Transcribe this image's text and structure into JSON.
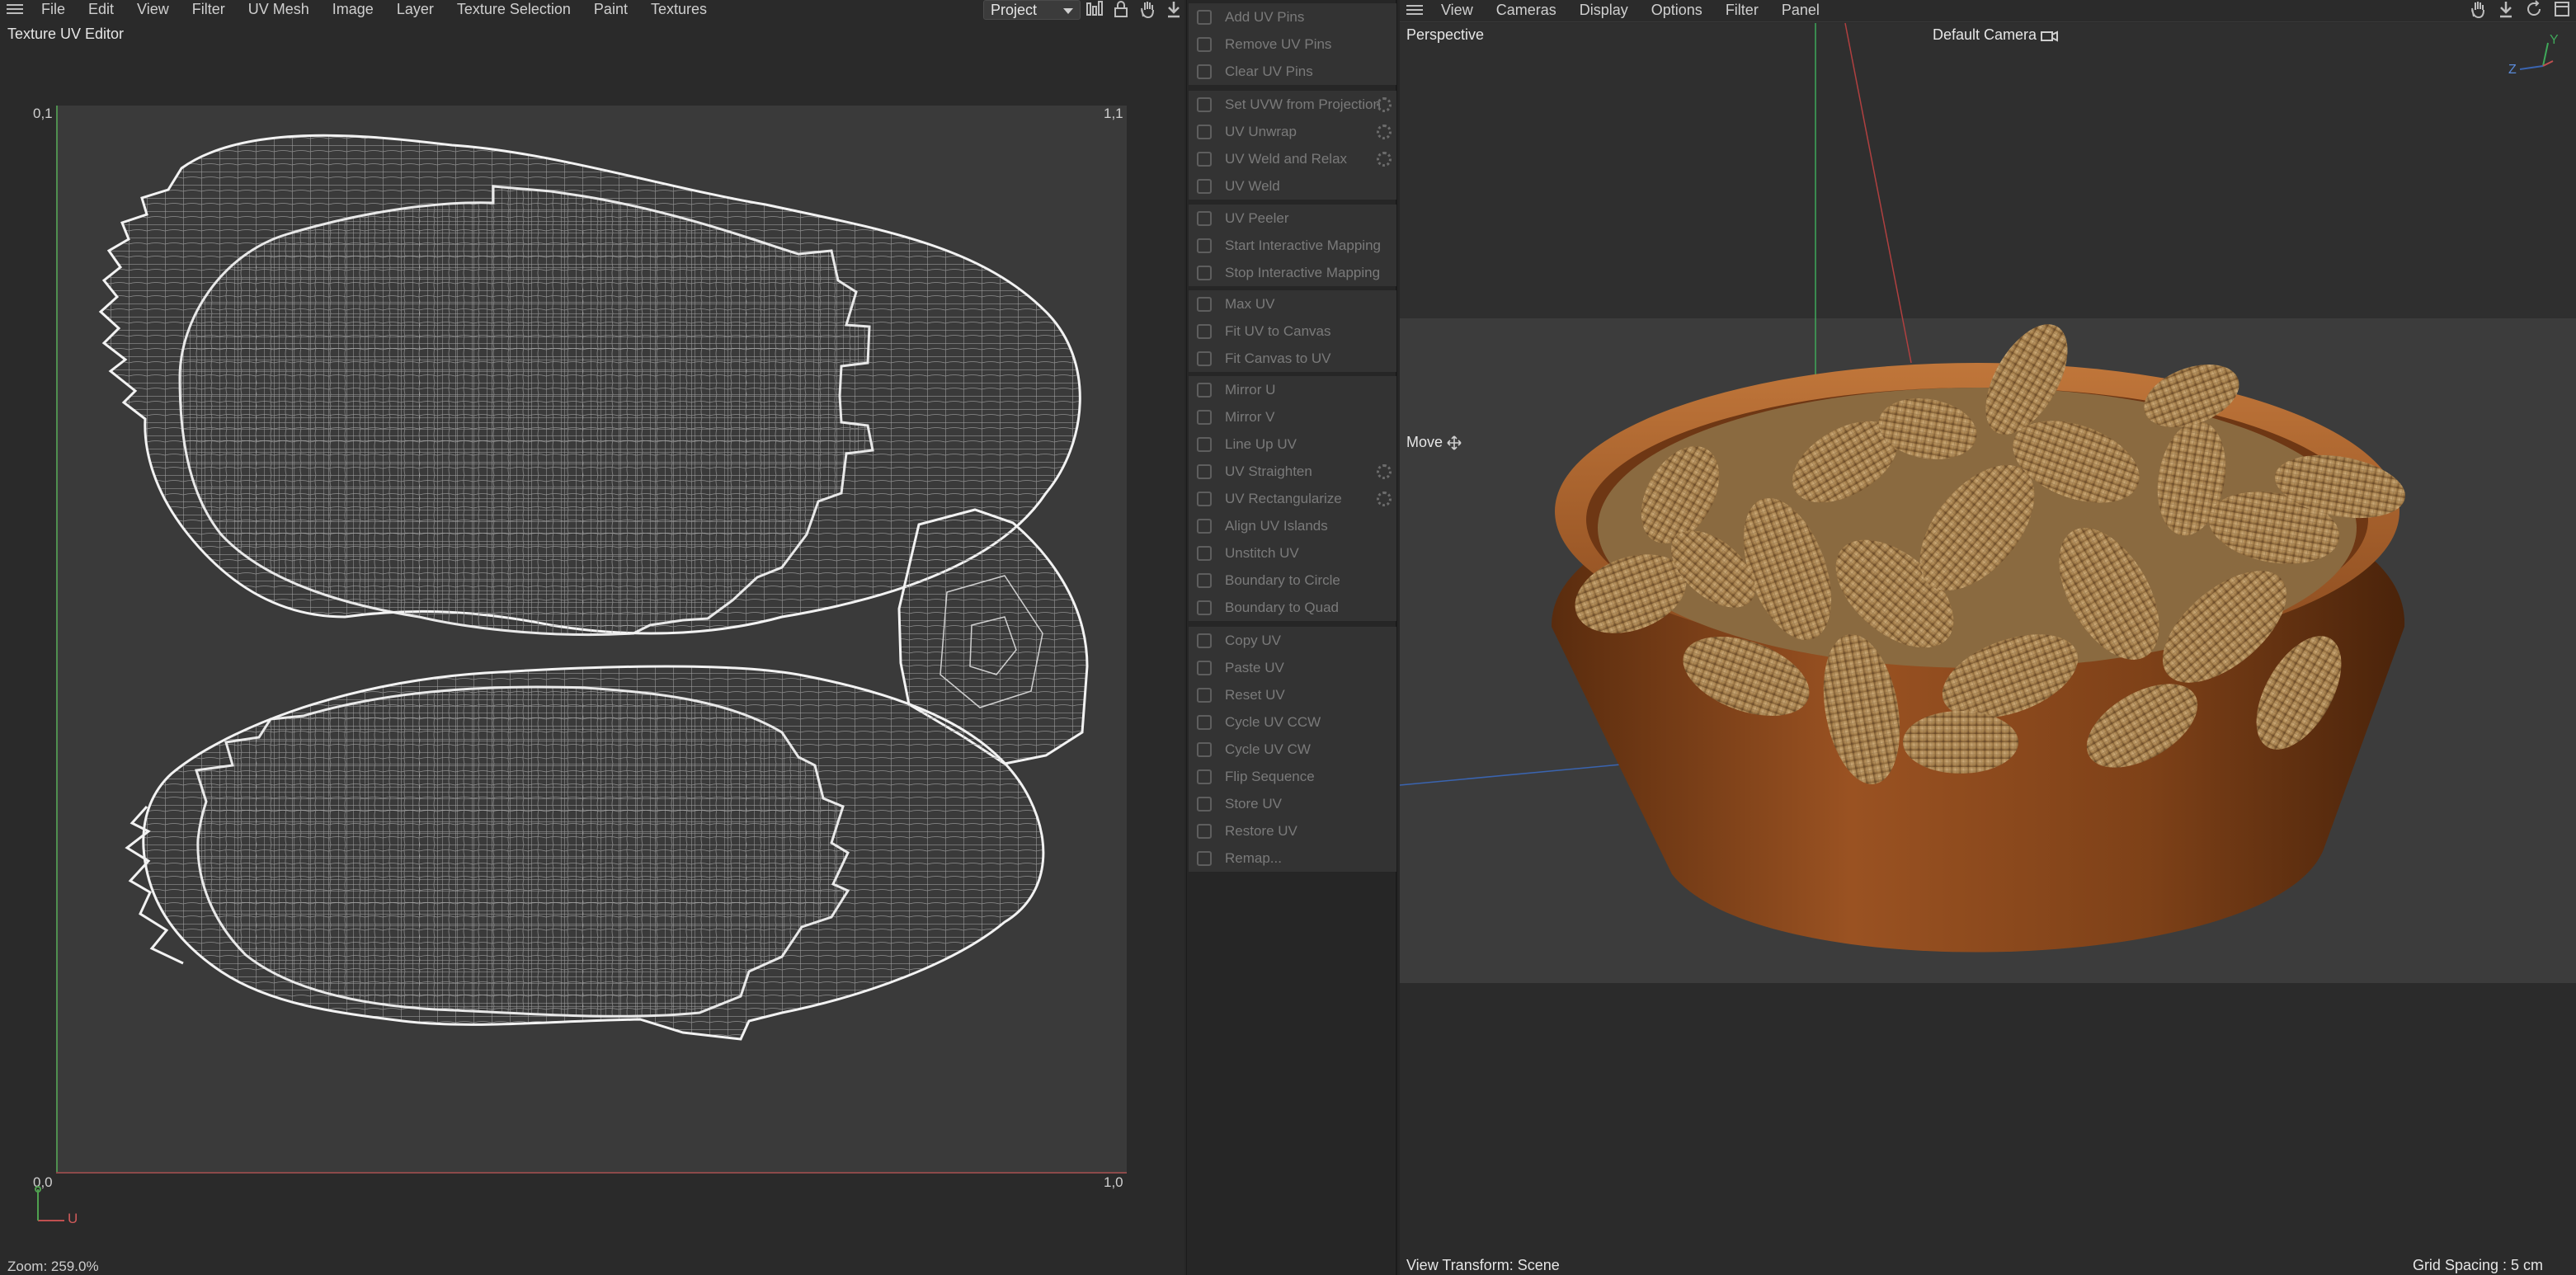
{
  "uv_editor": {
    "menu": [
      "File",
      "Edit",
      "View",
      "Filter",
      "UV Mesh",
      "Image",
      "Layer",
      "Texture Selection",
      "Paint",
      "Textures"
    ],
    "title": "Texture UV Editor",
    "project_select": "Project",
    "toolbar_icons": [
      "layout-icon",
      "lock-icon",
      "hand-icon",
      "download-icon"
    ],
    "corner_labels": {
      "top_left": "0,1",
      "top_right": "1,1",
      "bottom_left": "0,0",
      "bottom_right": "1,0"
    },
    "axis_label_u": "U",
    "zoom": "Zoom: 259.0%",
    "colors": {
      "canvas": "#3a3a3a",
      "mesh_line": "#d8d8d8",
      "v_axis": "#4f8f4f",
      "u_axis": "#8c4a4a"
    }
  },
  "commands": {
    "groups": [
      [
        {
          "label": "Add UV Pins",
          "icon": "pin-add-icon"
        },
        {
          "label": "Remove UV Pins",
          "icon": "pin-remove-icon"
        },
        {
          "label": "Clear UV Pins",
          "icon": "close-icon"
        }
      ],
      [
        {
          "label": "Set UVW from Projection",
          "icon": "projection-icon",
          "settings": true
        },
        {
          "label": "UV Unwrap",
          "icon": "unwrap-icon",
          "settings": true
        },
        {
          "label": "UV Weld and Relax",
          "icon": "weld-relax-icon",
          "settings": true
        },
        {
          "label": "UV Weld",
          "icon": "weld-icon"
        }
      ],
      [
        {
          "label": "UV Peeler",
          "icon": "peeler-icon"
        },
        {
          "label": "Start Interactive Mapping",
          "icon": "play-icon"
        },
        {
          "label": "Stop Interactive Mapping",
          "icon": "stop-icon"
        }
      ],
      [
        {
          "label": "Max UV",
          "icon": "max-uv-icon"
        },
        {
          "label": "Fit UV to Canvas",
          "icon": "fit-uv-icon"
        },
        {
          "label": "Fit Canvas to UV",
          "icon": "fit-canvas-icon"
        }
      ],
      [
        {
          "label": "Mirror U",
          "icon": "mirror-u-icon"
        },
        {
          "label": "Mirror V",
          "icon": "mirror-v-icon"
        },
        {
          "label": "Line Up UV",
          "icon": "line-up-icon"
        },
        {
          "label": "UV Straighten",
          "icon": "straighten-icon",
          "settings": true
        },
        {
          "label": "UV Rectangularize",
          "icon": "rectangularize-icon",
          "settings": true
        },
        {
          "label": "Align UV Islands",
          "icon": "align-icon"
        },
        {
          "label": "Unstitch UV",
          "icon": "unstitch-icon"
        },
        {
          "label": "Boundary to Circle",
          "icon": "circle-icon"
        },
        {
          "label": "Boundary to Quad",
          "icon": "quad-icon"
        }
      ],
      [
        {
          "label": "Copy UV",
          "icon": "copy-icon"
        },
        {
          "label": "Paste UV",
          "icon": "paste-icon"
        },
        {
          "label": "Reset UV",
          "icon": "reset-icon"
        },
        {
          "label": "Cycle UV CCW",
          "icon": "cycle-ccw-icon"
        },
        {
          "label": "Cycle UV CW",
          "icon": "cycle-cw-icon"
        },
        {
          "label": "Flip Sequence",
          "icon": "flip-icon"
        },
        {
          "label": "Store UV",
          "icon": "store-icon"
        },
        {
          "label": "Restore UV",
          "icon": "restore-icon"
        },
        {
          "label": "Remap...",
          "icon": "remap-icon"
        }
      ]
    ]
  },
  "viewport": {
    "menu": [
      "View",
      "Cameras",
      "Display",
      "Options",
      "Filter",
      "Panel"
    ],
    "projection_label": "Perspective",
    "camera_label": "Default Camera",
    "tool_label": "Move",
    "status_left": "View Transform: Scene",
    "status_right": "Grid Spacing : 5 cm",
    "axis_gizmo": {
      "y": "Y",
      "z": "Z"
    },
    "toolbar_icons": [
      "hand-icon",
      "arrow-down-icon",
      "rotate-icon",
      "maximize-icon"
    ],
    "colors": {
      "bowl": "#8a4a1e",
      "bowl_rim": "#b0642a",
      "peanut": "#b08a58",
      "peanut_dark": "#7a5a34",
      "floor": "#3c3c3c"
    }
  }
}
